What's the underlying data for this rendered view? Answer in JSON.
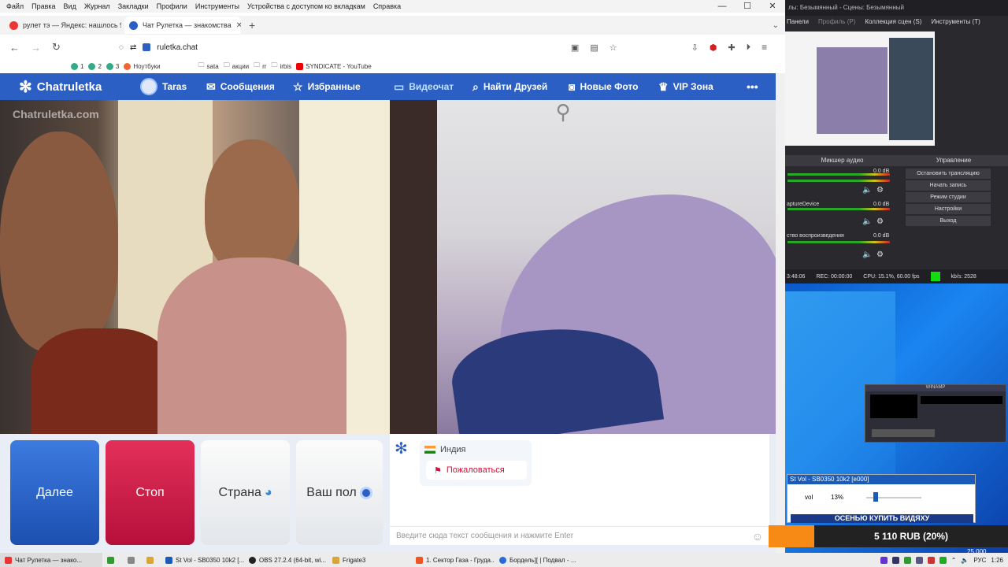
{
  "browser": {
    "menu": [
      "Файл",
      "Правка",
      "Вид",
      "Журнал",
      "Закладки",
      "Профили",
      "Инструменты",
      "Устройства с доступом ко вкладкам",
      "Справка"
    ],
    "tabs": [
      {
        "title": "рулет тэ — Яндекс: нашлось 9",
        "color": "#e33"
      },
      {
        "title": "Чат Рулетка — знакомства",
        "color": "#2b5fc4"
      }
    ],
    "url": "ruletka.chat",
    "bookmarks": [
      "1",
      "2",
      "3",
      "Ноутбуки",
      "sata",
      "акции",
      "rr",
      "irbis",
      "SYNDICATE - YouTube"
    ]
  },
  "site": {
    "logo": "Chatruletka",
    "watermark": "Chatruletka.com",
    "user": "Taras",
    "nav": [
      "Сообщения",
      "Избранные",
      "Видеочат",
      "Найти Друзей",
      "Новые Фото",
      "VIP Зона"
    ],
    "more": "•••"
  },
  "controls": {
    "next": "Далее",
    "stop": "Стоп",
    "country": "Страна",
    "gender": "Ваш пол"
  },
  "chat": {
    "country": "Индия",
    "report": "Пожаловаться",
    "input_placeholder": "Введите сюда текст сообщения и нажмите Enter"
  },
  "obs": {
    "title": "лы: Безымянный - Сцены: Безымянный",
    "menu": [
      "Панели",
      "Профиль (P)",
      "Коллекция сцен (S)",
      "Инструменты (T)"
    ],
    "mixer_title": "Микшер аудио",
    "control_title": "Управление",
    "buttons": [
      "Остановить трансляцию",
      "Начать запись",
      "Режим студии",
      "Настройки",
      "Выход"
    ],
    "channels": [
      {
        "name": "",
        "db": "0.0 dB"
      },
      {
        "name": "aptureDevice",
        "db": "0.0 dB"
      },
      {
        "name": "ство воспроизведения",
        "db": "0.0 dB"
      }
    ],
    "status": {
      "time": "3:48:06",
      "rec": "REC: 00:00:00",
      "cpu": "CPU: 15.1%, 60.00 fps",
      "kbs": "kb/s: 2528"
    }
  },
  "desktop": {
    "winamp": "WINAMP",
    "stvol_title": "St Vol - SB0350 10k2 [e000]",
    "vol_label": "vol",
    "vol_value": "13%",
    "vol_fraction": 0.13,
    "banner": "ОСЕНЬЮ КУПИТЬ ВИДЯХУ",
    "donation": "5 110 RUB (20%)",
    "donation_small": "25 000"
  },
  "taskbar": {
    "items": [
      "Чат Рулетка — знако...",
      "St Vol - SB0350 10k2 [...",
      "OBS 27.2.4 (64-bit, wi...",
      "Frigate3",
      "1. Сектор Газа - Груда...",
      "Бордель][ | Подвал - ..."
    ],
    "lang": "РУС",
    "clock": "1:26"
  }
}
